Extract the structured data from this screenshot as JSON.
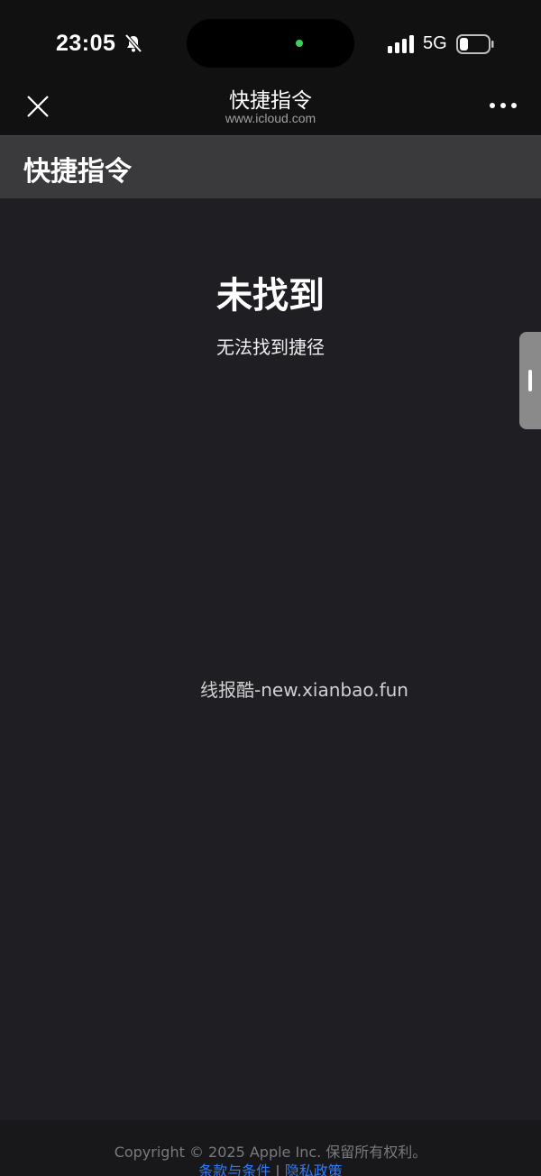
{
  "status_bar": {
    "time": "23:05",
    "network": "5G",
    "icons": [
      "bell-slash-icon",
      "cellular-signal-icon",
      "battery-icon"
    ],
    "privacy_indicator_color": "#3ad05a"
  },
  "nav": {
    "title": "快捷指令",
    "subtitle": "www.icloud.com",
    "close_icon": "close-icon",
    "more_icon": "more-icon"
  },
  "header": {
    "title": "快捷指令"
  },
  "main": {
    "error_title": "未找到",
    "error_message": "无法找到捷径",
    "watermark": "线报酷-new.xianbao.fun"
  },
  "footer": {
    "copyright": "Copyright © 2025 Apple Inc. 保留所有权利。",
    "terms_link": "条款与条件",
    "separator": "|",
    "privacy_link": "隐私政策",
    "link_color": "#2f7bf5"
  }
}
